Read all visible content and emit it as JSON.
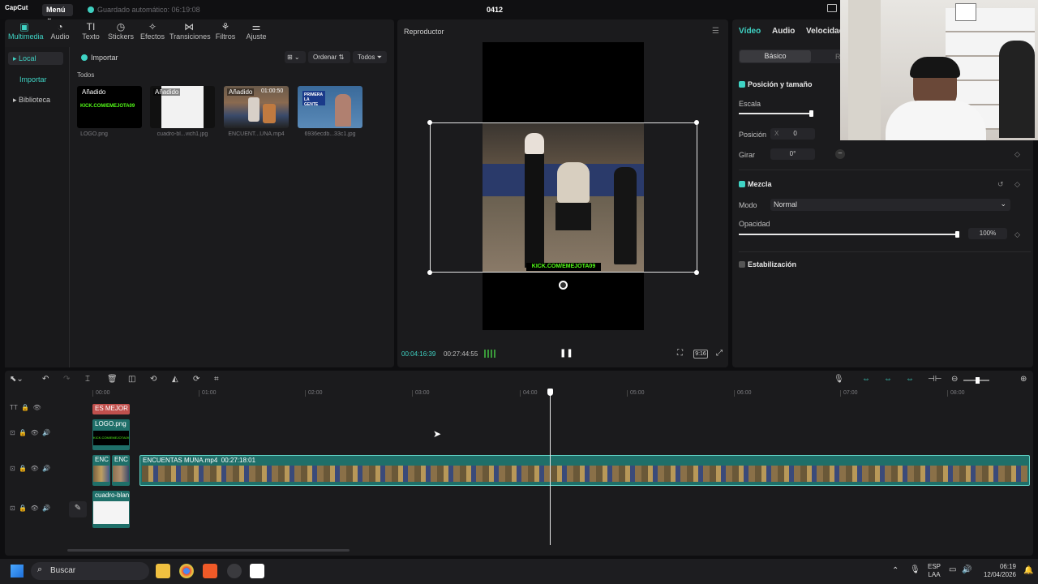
{
  "titlebar": {
    "logo": "CapCut",
    "menu": "Menú",
    "autosave": "Guardado automático: 06:19:08",
    "project_title": "0412"
  },
  "toolbar": {
    "tools": [
      "Multimedia",
      "Audio",
      "Texto",
      "Stickers",
      "Efectos",
      "Transiciones",
      "Filtros",
      "Ajuste"
    ]
  },
  "sidebar": {
    "local": "Local",
    "import": "Importar",
    "library": "Biblioteca"
  },
  "media": {
    "import_btn": "Importar",
    "sort": "Ordenar",
    "filter": "Todos",
    "section": "Todos",
    "items": [
      {
        "badge": "Añadido",
        "name": "LOGO.png",
        "logo_text": "KICK.COM/EMEJOTA09"
      },
      {
        "badge": "Añadido",
        "name": "cuadro-bl...vich1.jpg"
      },
      {
        "badge": "Añadido",
        "duration": "01:00:50",
        "name": "ENCUENT...UNA.mp4"
      },
      {
        "name": "6936ecdb...33c1.jpg",
        "banner": "PRIMERA LA GENTE"
      }
    ]
  },
  "player": {
    "title": "Reproductor",
    "overlay": "KICK.COM/EMEJOTA09",
    "time_current": "00:04:16:39",
    "time_total": "00:27:44:55",
    "ratio": "9:16"
  },
  "props": {
    "tabs": [
      "Vídeo",
      "Audio",
      "Velocidad"
    ],
    "subtabs": [
      "Básico",
      "R"
    ],
    "position_size": "Posición y tamaño",
    "scale_label": "Escala",
    "position_label": "Posición",
    "pos_x_label": "X",
    "pos_x": "0",
    "pos_y_label": "Y",
    "rotate_label": "Girar",
    "rotate": "0°",
    "blend": "Mezcla",
    "mode_label": "Modo",
    "mode": "Normal",
    "opacity_label": "Opacidad",
    "opacity": "100%",
    "stabilization": "Estabilización",
    "scale_fraction": 0.98,
    "opacity_fraction": 1.0
  },
  "timeline": {
    "ticks": [
      "00:00",
      "01:00",
      "02:00",
      "03:00",
      "04:00",
      "05:00",
      "06:00",
      "07:00",
      "08:00"
    ],
    "text_clip": "ES MEJOR N",
    "logo_clip": "LOGO.png",
    "logo_clip_text": "KICK.COM/EMEJOTA09",
    "video_small_1": "ENC",
    "video_small_2": "ENC",
    "main_clip": "ENCUENTAS MUNA.mp4",
    "main_clip_duration": "00:27:18:01",
    "image_clip": "cuadro-blan"
  },
  "taskbar": {
    "search": "Buscar",
    "lang_1": "ESP",
    "lang_2": "LAA",
    "time": "06:19",
    "date": "12/04/2026"
  },
  "colors": {
    "accent": "#3fd3c4",
    "panel": "#1b1b1d",
    "background": "#0e0e10",
    "text_clip": "#c0504d",
    "video_track": "#1f6f69"
  }
}
